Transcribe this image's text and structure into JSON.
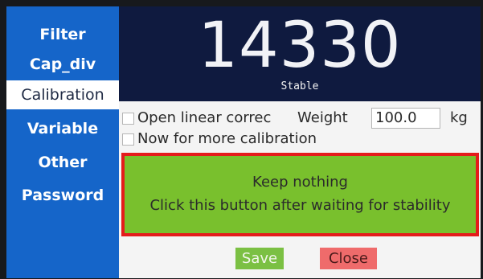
{
  "sidebar": {
    "items": [
      {
        "label": "Filter"
      },
      {
        "label": "Cap_div"
      },
      {
        "label": "Calibration"
      },
      {
        "label": "Variable"
      },
      {
        "label": "Other"
      },
      {
        "label": "Password"
      }
    ]
  },
  "display": {
    "value": "14330",
    "status": "Stable"
  },
  "options": {
    "linear_label": "Open linear correc",
    "weight_label": "Weight",
    "weight_value": "100.0",
    "weight_unit": "kg",
    "more_label": "Now for more calibration"
  },
  "action": {
    "line1": "Keep nothing",
    "line2": "Click this button after waiting for stability"
  },
  "buttons": {
    "save": "Save",
    "close": "Close"
  },
  "colors": {
    "sidebar": "#1565c9",
    "display_bg": "#0f1a3f",
    "action_bg": "#79c02d",
    "action_border": "#e41b1b",
    "save_bg": "#7bc043",
    "close_bg": "#ef6b6b"
  }
}
